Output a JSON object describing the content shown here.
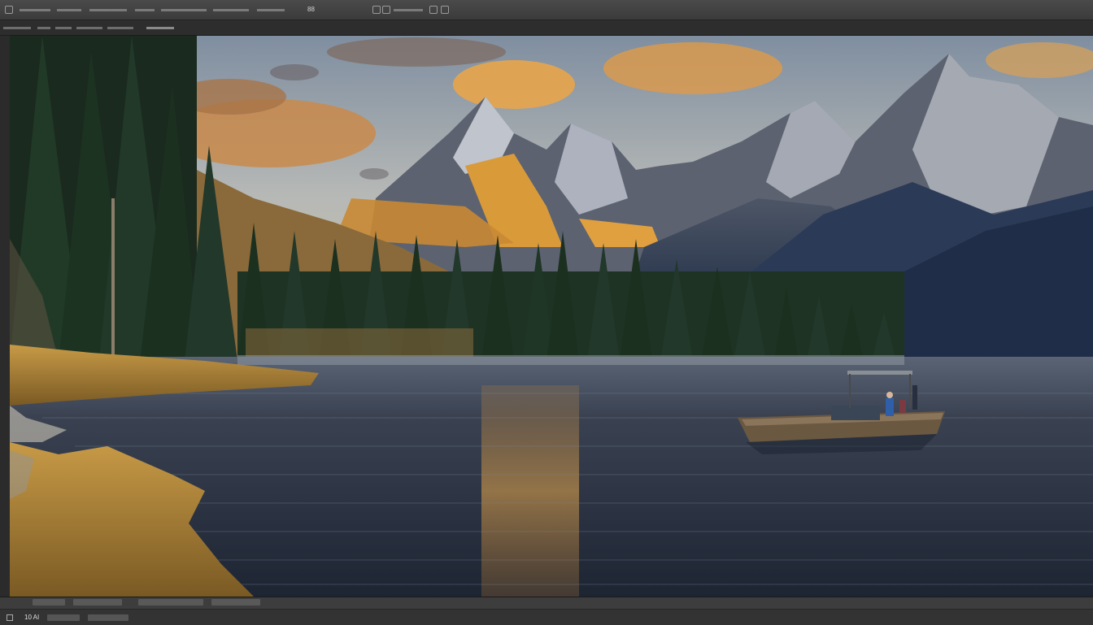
{
  "menubar": {
    "workspace_label": "88"
  },
  "tabbar": {
    "tabs": [
      "",
      "",
      "",
      "",
      ""
    ]
  },
  "canvas": {
    "image_subject": "mountain-lake-landscape"
  },
  "statusbar": {
    "zoom": "10 AI"
  },
  "colors": {
    "chrome_dark": "#2d2d2d",
    "chrome_mid": "#3b3b3b",
    "sky_top": "#9aa6b4",
    "sunset_orange": "#e8a54a",
    "water_dark": "#1f2a38"
  }
}
